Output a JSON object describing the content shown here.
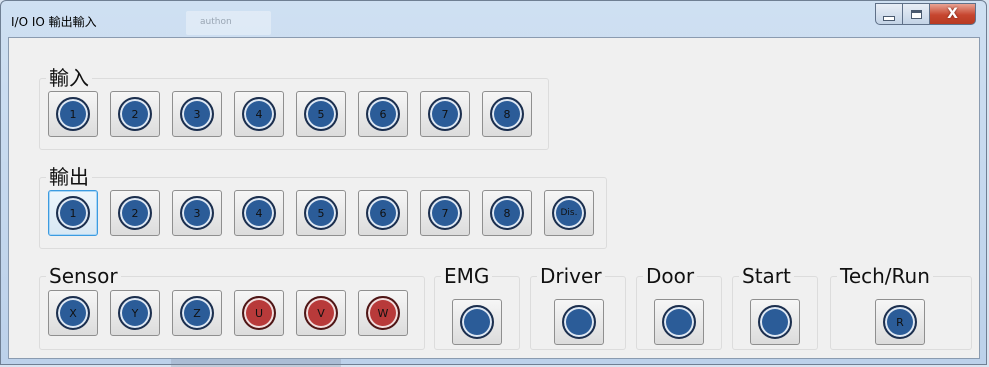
{
  "window": {
    "title": "I/O IO 輸出輸入",
    "ghost_tab": "authon"
  },
  "controls": {
    "close_glyph": "X"
  },
  "input_group": {
    "label": "輸入",
    "lamps": [
      {
        "label": "1",
        "color": "blue"
      },
      {
        "label": "2",
        "color": "blue"
      },
      {
        "label": "3",
        "color": "blue"
      },
      {
        "label": "4",
        "color": "blue"
      },
      {
        "label": "5",
        "color": "blue"
      },
      {
        "label": "6",
        "color": "blue"
      },
      {
        "label": "7",
        "color": "blue"
      },
      {
        "label": "8",
        "color": "blue"
      }
    ]
  },
  "output_group": {
    "label": "輸出",
    "buttons": [
      {
        "label": "1",
        "color": "blue"
      },
      {
        "label": "2",
        "color": "blue"
      },
      {
        "label": "3",
        "color": "blue"
      },
      {
        "label": "4",
        "color": "blue"
      },
      {
        "label": "5",
        "color": "blue"
      },
      {
        "label": "6",
        "color": "blue"
      },
      {
        "label": "7",
        "color": "blue"
      },
      {
        "label": "8",
        "color": "blue"
      },
      {
        "label": "Dis.",
        "color": "blue"
      }
    ]
  },
  "sensor_group": {
    "label": "Sensor",
    "lamps": [
      {
        "label": "X",
        "color": "blue"
      },
      {
        "label": "Y",
        "color": "blue"
      },
      {
        "label": "Z",
        "color": "blue"
      },
      {
        "label": "U",
        "color": "red"
      },
      {
        "label": "V",
        "color": "red"
      },
      {
        "label": "W",
        "color": "red"
      }
    ]
  },
  "emg_group": {
    "label": "EMG"
  },
  "driver_group": {
    "label": "Driver"
  },
  "door_group": {
    "label": "Door"
  },
  "start_group": {
    "label": "Start"
  },
  "techrun_group": {
    "label": "Tech/Run",
    "button_label": "R"
  },
  "colors": {
    "lamp_blue": "#2b5c98",
    "lamp_red": "#b83a3a",
    "focus": "#3c9be0"
  }
}
